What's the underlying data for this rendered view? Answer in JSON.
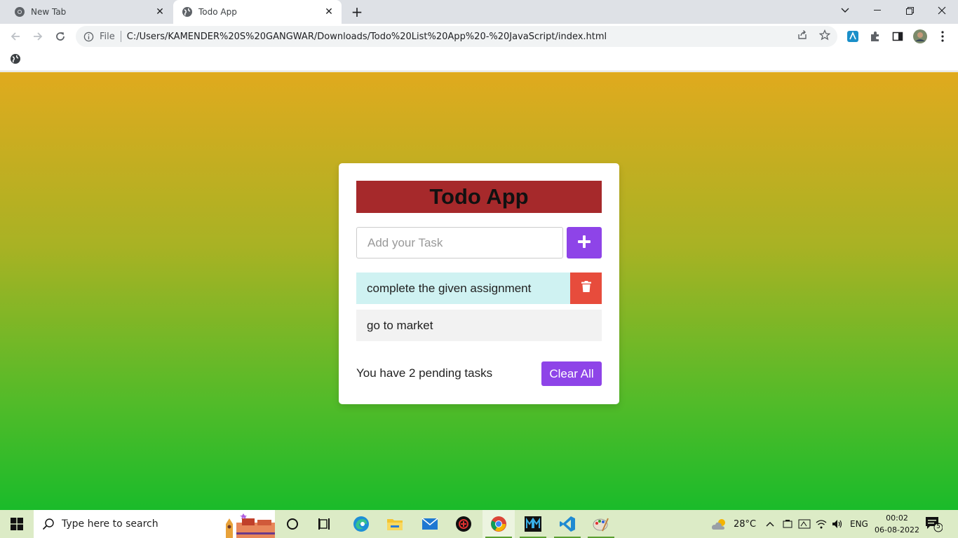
{
  "browser": {
    "tabs": [
      {
        "title": "New Tab",
        "active": false
      },
      {
        "title": "Todo App",
        "active": true
      }
    ],
    "address": {
      "scheme_label": "File",
      "url": "C:/Users/KAMENDER%20S%20GANGWAR/Downloads/Todo%20List%20App%20-%20JavaScript/index.html"
    }
  },
  "app": {
    "title": "Todo App",
    "input_placeholder": "Add your Task",
    "tasks": [
      {
        "text": "complete the given assignment"
      },
      {
        "text": "go to market"
      }
    ],
    "pending_text": "You have 2 pending tasks",
    "clear_label": "Clear All"
  },
  "colors": {
    "title_bg": "#a6292b",
    "accent_purple": "#8e44e8",
    "delete_red": "#e74c3c",
    "gradient_top": "#e0aa1e",
    "gradient_bottom": "#1abb2a"
  },
  "taskbar": {
    "search_placeholder": "Type here to search",
    "weather": "28°C",
    "language": "ENG",
    "time": "00:02",
    "date": "06-08-2022",
    "notification_count": "5"
  }
}
